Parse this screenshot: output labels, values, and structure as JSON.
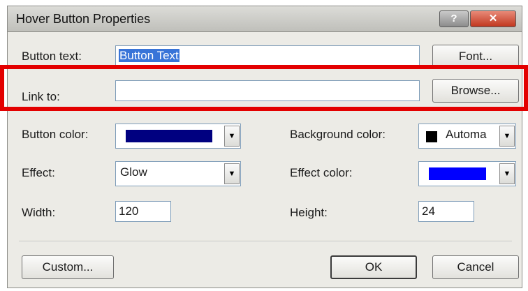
{
  "window": {
    "title": "Hover Button Properties",
    "help_label": "?",
    "close_label": "✕"
  },
  "button_text": {
    "label": "Button text:",
    "value": "Button Text"
  },
  "font_button": "Font...",
  "link_to": {
    "label": "Link to:",
    "value": ""
  },
  "browse_button": "Browse...",
  "button_color": {
    "label": "Button color:",
    "color": "#000080"
  },
  "background_color": {
    "label": "Background color:",
    "value": "Automa",
    "color": "#000000"
  },
  "effect": {
    "label": "Effect:",
    "value": "Glow"
  },
  "effect_color": {
    "label": "Effect color:",
    "color": "#0000ff"
  },
  "width": {
    "label": "Width:",
    "value": "120"
  },
  "height": {
    "label": "Height:",
    "value": "24"
  },
  "custom_button": "Custom...",
  "ok_button": "OK",
  "cancel_button": "Cancel",
  "highlight_color": "#e30000",
  "dropdown_glyph": "▼"
}
